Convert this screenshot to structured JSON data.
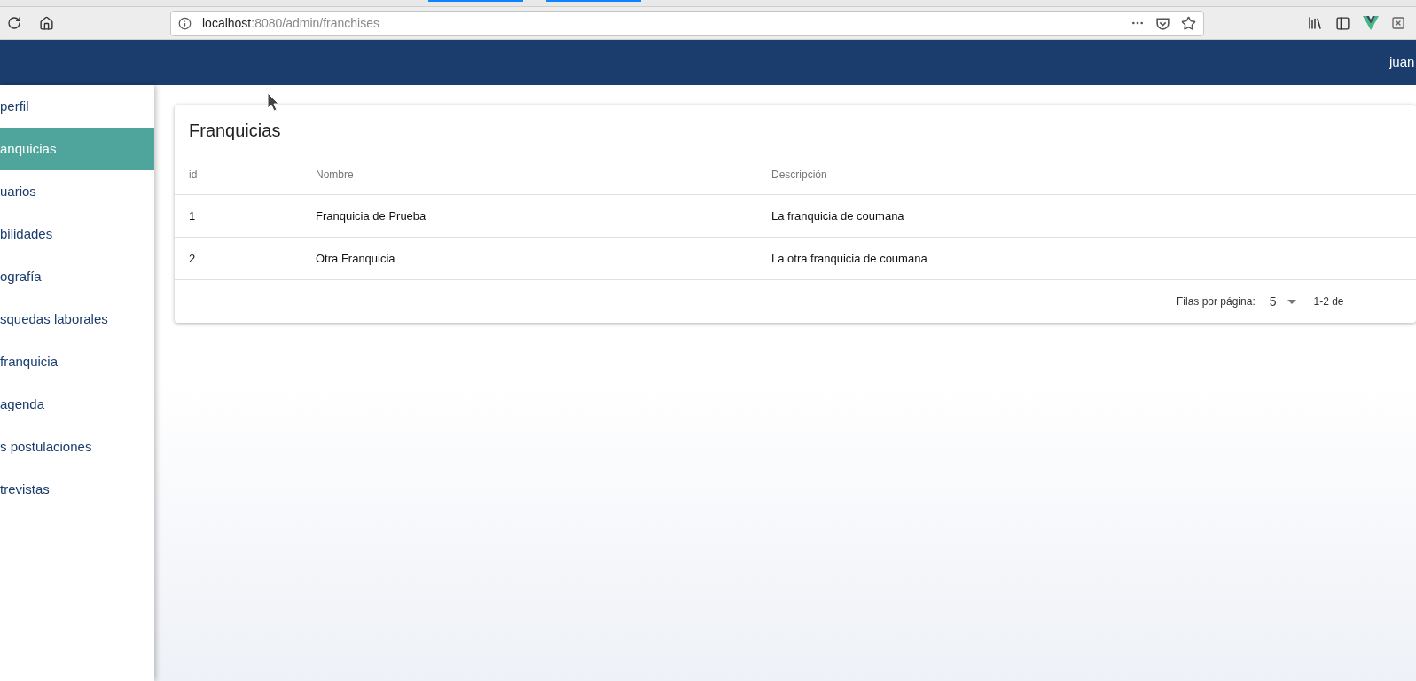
{
  "browser": {
    "url_host": "localhost",
    "url_path": ":8080/admin/franchises"
  },
  "app_bar": {
    "user": "juan"
  },
  "sidebar": {
    "items": [
      {
        "label": "perfil",
        "selected": false
      },
      {
        "label": "anquicias",
        "selected": true
      },
      {
        "label": "uarios",
        "selected": false
      },
      {
        "label": "bilidades",
        "selected": false
      },
      {
        "label": "ografía",
        "selected": false
      },
      {
        "label": "squedas laborales",
        "selected": false
      },
      {
        "label": "franquicia",
        "selected": false
      },
      {
        "label": "agenda",
        "selected": false
      },
      {
        "label": "s postulaciones",
        "selected": false
      },
      {
        "label": "trevistas",
        "selected": false
      }
    ]
  },
  "card": {
    "title": "Franquicias",
    "table": {
      "columns": [
        "id",
        "Nombre",
        "Descripción"
      ],
      "rows": [
        [
          "1",
          "Franquicia de Prueba",
          "La franquicia de coumana"
        ],
        [
          "2",
          "Otra Franquicia",
          "La otra franquicia de coumana"
        ]
      ]
    },
    "pagination": {
      "rows_label": "Filas por página:",
      "rows_value": "5",
      "range": "1-2 de"
    }
  }
}
